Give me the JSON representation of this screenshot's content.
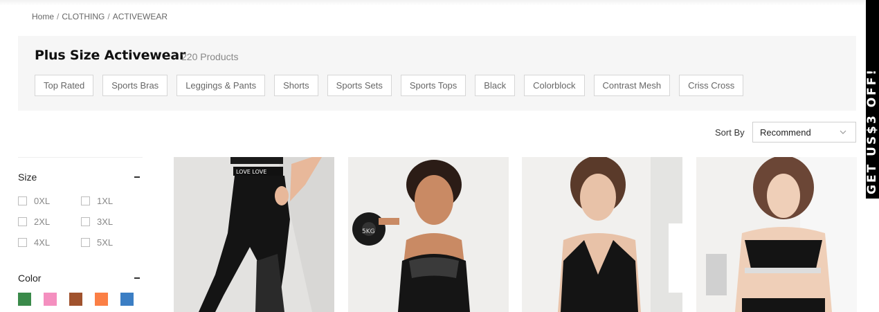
{
  "breadcrumb": {
    "home": "Home",
    "sep1": "/",
    "clothing": "CLOTHING",
    "sep2": "/",
    "activewear": "ACTIVEWEAR"
  },
  "header": {
    "title": "Plus Size Activewear",
    "count": "220 Products"
  },
  "chips": [
    "Top Rated",
    "Sports Bras",
    "Leggings & Pants",
    "Shorts",
    "Sports Sets",
    "Sports Tops",
    "Black",
    "Colorblock",
    "Contrast Mesh",
    "Criss Cross"
  ],
  "sort": {
    "label": "Sort By",
    "value": "Recommend"
  },
  "filters": {
    "size": {
      "title": "Size",
      "options": [
        "0XL",
        "1XL",
        "2XL",
        "3XL",
        "4XL",
        "5XL"
      ]
    },
    "color": {
      "title": "Color",
      "swatches": [
        "#3a8a4a",
        "#f48fbf",
        "#a0522d",
        "#fb7f45",
        "#3b7ec4"
      ]
    }
  },
  "promo": {
    "text": "GET US$3 OFF!"
  },
  "colors": {
    "panel": "#f6f6f6",
    "promo_bg": "#000000"
  }
}
